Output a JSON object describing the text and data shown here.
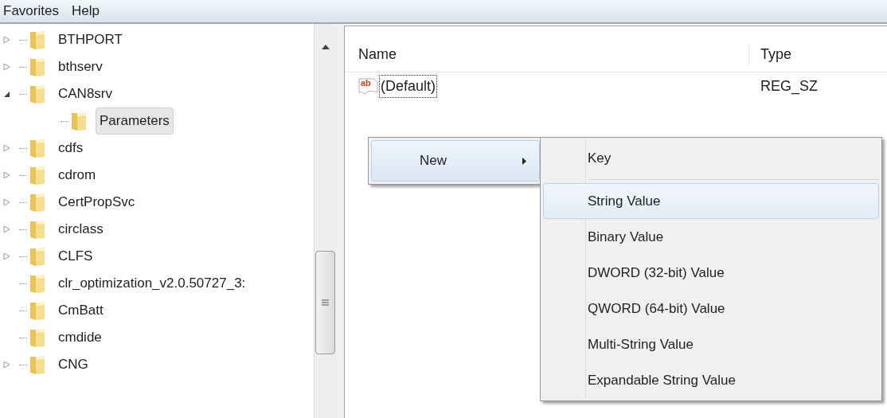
{
  "menu_bar": [
    {
      "label": "Favorites"
    },
    {
      "label": "Help"
    }
  ],
  "tree": [
    {
      "label": "BTHPORT",
      "expanded": false,
      "selected": false
    },
    {
      "label": "bthserv",
      "expanded": false,
      "selected": false
    },
    {
      "label": "CAN8srv",
      "expanded": true,
      "selected": false,
      "children": [
        {
          "label": "Parameters",
          "selected": true
        }
      ]
    },
    {
      "label": "cdfs",
      "expanded": false,
      "selected": false
    },
    {
      "label": "cdrom",
      "expanded": false,
      "selected": false
    },
    {
      "label": "CertPropSvc",
      "expanded": false,
      "selected": false
    },
    {
      "label": "circlass",
      "expanded": false,
      "selected": false
    },
    {
      "label": "CLFS",
      "expanded": false,
      "selected": false
    },
    {
      "label": "clr_optimization_v2.0.50727_3:",
      "selected": false
    },
    {
      "label": "CmBatt",
      "selected": false
    },
    {
      "label": "cmdide",
      "selected": false
    },
    {
      "label": "CNG",
      "expanded": false,
      "selected": false
    }
  ],
  "values_list": {
    "columns": [
      "Name",
      "Type"
    ],
    "rows": [
      {
        "icon_text": "ab",
        "name": "(Default)",
        "type": "REG_SZ",
        "focused": true
      }
    ]
  },
  "context_menu": [
    {
      "label": "New",
      "has_submenu": true,
      "selected": true
    }
  ],
  "submenu": [
    {
      "kind": "item",
      "label": "Key",
      "selected": false
    },
    {
      "kind": "separator"
    },
    {
      "kind": "item",
      "label": "String Value",
      "selected": true
    },
    {
      "kind": "item",
      "label": "Binary Value",
      "selected": false
    },
    {
      "kind": "item",
      "label": "DWORD (32-bit) Value",
      "selected": false
    },
    {
      "kind": "item",
      "label": "QWORD (64-bit) Value",
      "selected": false
    },
    {
      "kind": "item",
      "label": "Multi-String Value",
      "selected": false
    },
    {
      "kind": "item",
      "label": "Expandable String Value",
      "selected": false
    }
  ]
}
